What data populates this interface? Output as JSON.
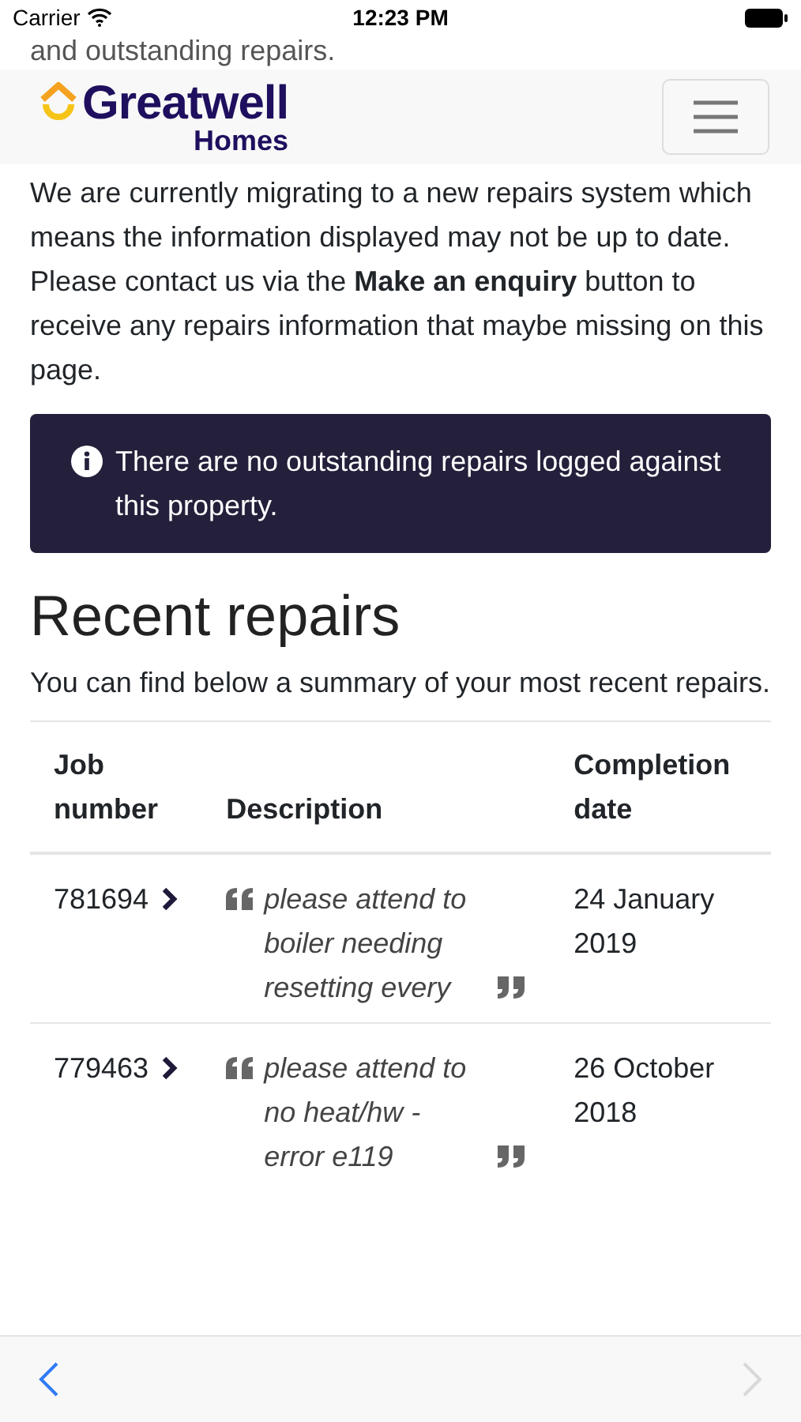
{
  "status_bar": {
    "carrier": "Carrier",
    "time": "12:23 PM"
  },
  "intro_tail": "and outstanding repairs.",
  "header": {
    "logo_word": "Greatwell",
    "logo_sub": "Homes"
  },
  "notice": "We are currently migrating to a new repairs system which means the information displayed may not be up to date. Please contact us via the **Make an enquiry** button to receive any repairs information that maybe missing on this page.",
  "alert": "There are no outstanding repairs logged against this property.",
  "section": {
    "title": "Recent repairs",
    "subtitle": "You can find below a summary of your most recent repairs."
  },
  "table": {
    "columns": [
      "Job number",
      "Description",
      "Completion date"
    ],
    "rows": [
      {
        "job": "781694",
        "description": "please attend to boiler needing resetting every",
        "date": "24 January 2019"
      },
      {
        "job": "779463",
        "description": "please attend to no heat/hw - error e119",
        "date": "26 October 2018"
      }
    ]
  },
  "browser_toolbar": {
    "back_disabled": false,
    "forward_disabled": true
  }
}
